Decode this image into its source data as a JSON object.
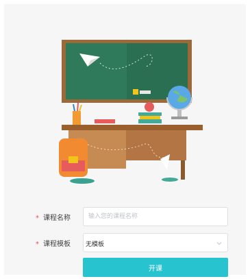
{
  "form": {
    "required_mark": "*",
    "course_name": {
      "label": "课程名称",
      "placeholder": "输入您的课程名称",
      "value": ""
    },
    "course_template": {
      "label": "课程模板",
      "selected": "无模板"
    },
    "submit_label": "开课"
  },
  "illustration": {
    "title": "classroom-illustration"
  },
  "colors": {
    "accent": "#27c3cf",
    "required": "#e8504f",
    "chalkboard": "#2f7a5b",
    "frame": "#9b6a3a",
    "desk": "#b87a44"
  }
}
